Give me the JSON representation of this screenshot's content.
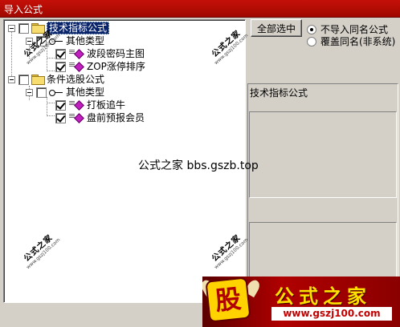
{
  "window": {
    "title": "导入公式"
  },
  "tree": {
    "nodes": [
      {
        "label": "技术指标公式",
        "type": "folder",
        "checked": false,
        "selected": true
      },
      {
        "label": "其他类型",
        "type": "category",
        "checked": false
      },
      {
        "label": "波段密码主图",
        "type": "formula",
        "checked": true
      },
      {
        "label": "ZOP涨停排序",
        "type": "formula",
        "checked": true
      },
      {
        "label": "条件选股公式",
        "type": "folder",
        "checked": false
      },
      {
        "label": "其他类型",
        "type": "category",
        "checked": false
      },
      {
        "label": "打板追牛",
        "type": "formula",
        "checked": true
      },
      {
        "label": "盘前预报会员",
        "type": "formula",
        "checked": true
      }
    ]
  },
  "controls": {
    "select_all_label": "全部选中",
    "radio_options": [
      {
        "label": "不导入同名公式",
        "selected": true
      },
      {
        "label": "覆盖同名(非系统)",
        "selected": false
      }
    ]
  },
  "info": {
    "caption": "技术指标公式"
  },
  "watermark": {
    "center_text": "公式之家 bbs.gszb.top",
    "stamp_text": "公式之家",
    "stamp_url": "www.gszj100.com"
  },
  "banner": {
    "logo_char": "股",
    "name": "公式之家",
    "url": "www.gszj100.com"
  },
  "colors": {
    "titlebar": "#b00c04",
    "selection": "#0a246a",
    "banner_text": "#ffe000"
  }
}
